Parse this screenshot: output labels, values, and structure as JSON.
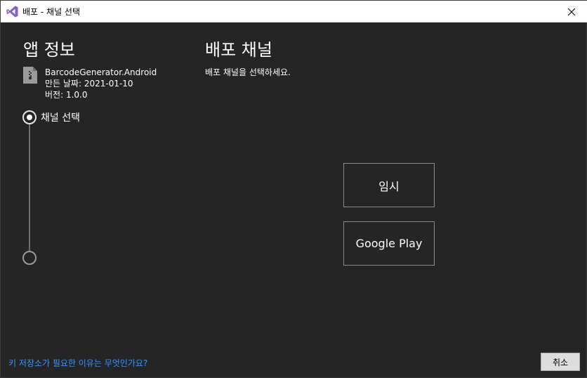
{
  "window": {
    "title": "배포 - 채널 선택",
    "close_glyph": "✕"
  },
  "app_info": {
    "heading": "앱 정보",
    "app_name": "BarcodeGenerator.Android",
    "created": "만든 날짜: 2021-01-10",
    "version": "버전: 1.0.0"
  },
  "steps": [
    {
      "label": "채널 선택",
      "active": true
    },
    {
      "label": "",
      "active": false
    }
  ],
  "channel": {
    "heading": "배포 채널",
    "subtitle": "배포 채널을 선택하세요.",
    "buttons": [
      {
        "label": "임시"
      },
      {
        "label": "Google Play"
      }
    ]
  },
  "footer": {
    "help_link": "키 저장소가 필요한 이유는 무엇인가요?",
    "cancel_label": "취소"
  },
  "colors": {
    "background": "#252526",
    "link": "#3794ff",
    "vs_purple": "#865fc5"
  }
}
